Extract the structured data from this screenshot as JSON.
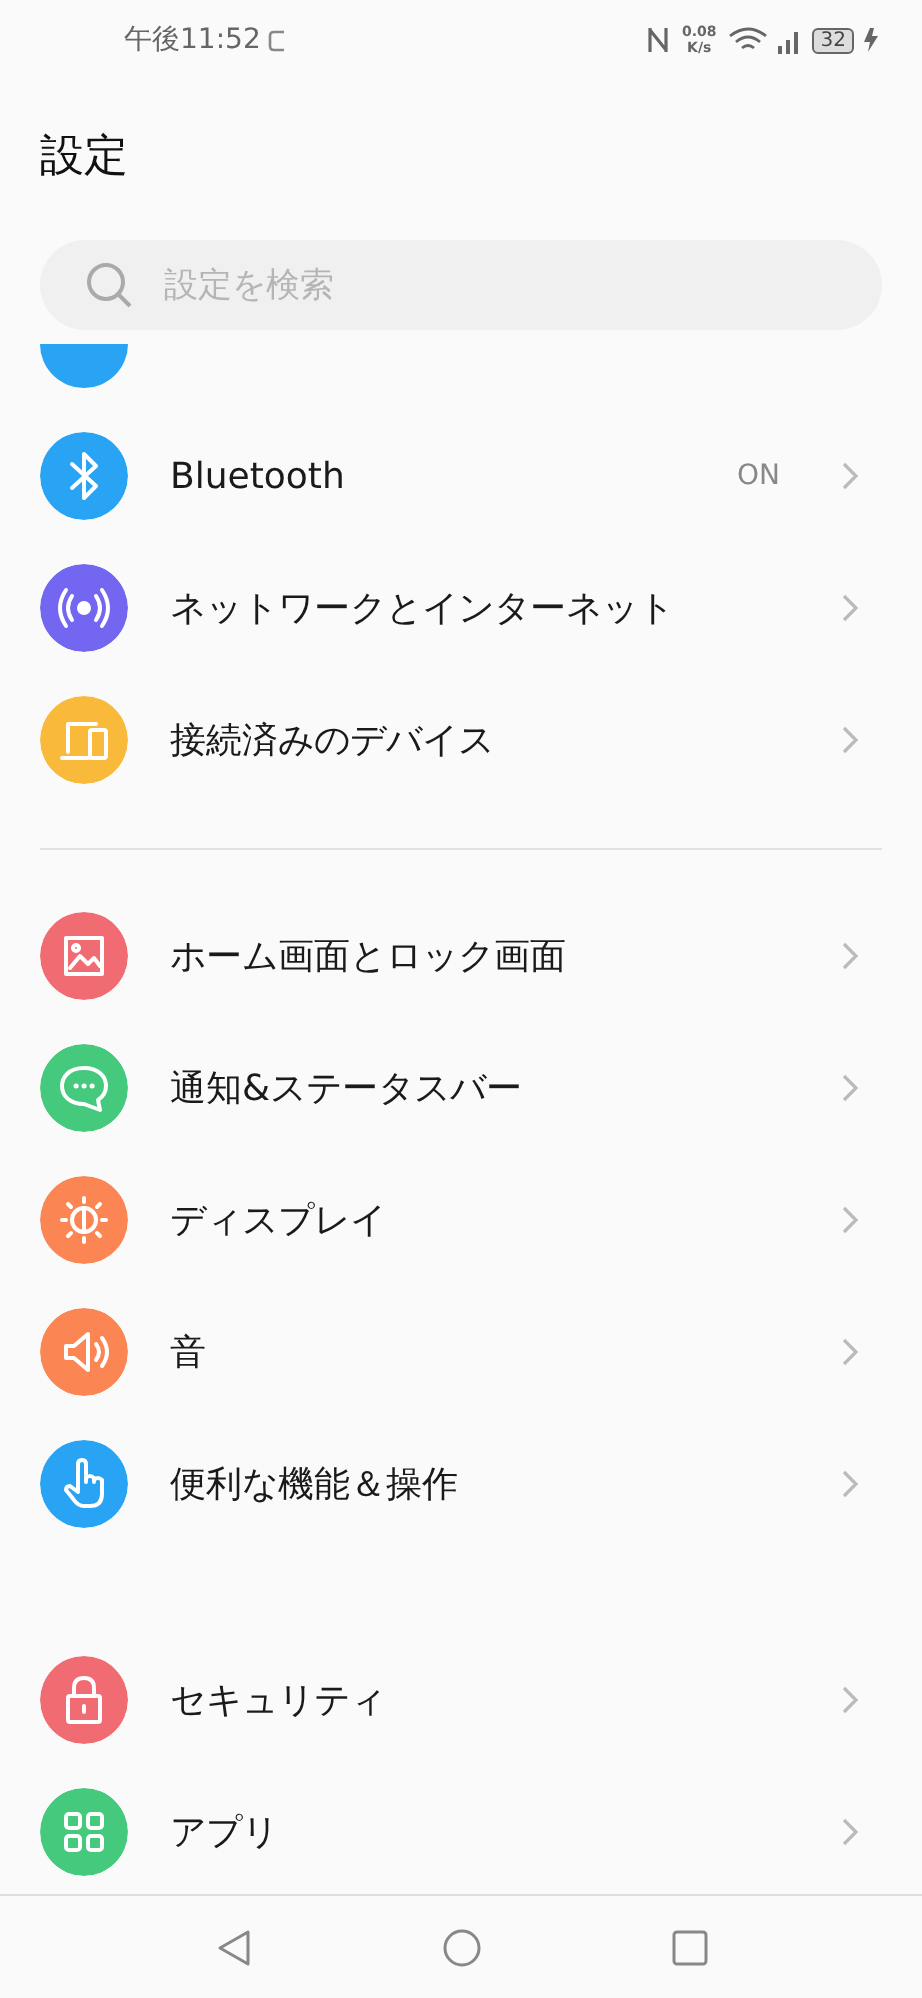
{
  "status_bar": {
    "time": "午後11:52",
    "speed_value": "0.08",
    "speed_unit": "K/s",
    "battery": "32"
  },
  "title": "設定",
  "search": {
    "placeholder": "設定を検索"
  },
  "groups": [
    {
      "items": [
        {
          "kind": "clipped",
          "color": "#29a3f3"
        },
        {
          "kind": "row",
          "label": "Bluetooth",
          "value": "ON",
          "color": "#29a3f3"
        },
        {
          "kind": "row",
          "label": "ネットワークとインターネット",
          "color": "#7366f0"
        },
        {
          "kind": "row",
          "label": "接続済みのデバイス",
          "color": "#f9b93a"
        }
      ]
    },
    {
      "divider": true,
      "items": [
        {
          "kind": "row",
          "label": "ホーム画面とロック画面",
          "color": "#f06b72"
        },
        {
          "kind": "row",
          "label": "通知&ステータスバー",
          "color": "#44c97d"
        },
        {
          "kind": "row",
          "label": "ディスプレイ",
          "color": "#fb8654"
        },
        {
          "kind": "row",
          "label": "音",
          "color": "#fb8654"
        },
        {
          "kind": "row",
          "label": "便利な機能＆操作",
          "color": "#29a3f3"
        }
      ]
    },
    {
      "divider": false,
      "items": [
        {
          "kind": "row",
          "label": "セキュリティ",
          "color": "#f06b72"
        },
        {
          "kind": "row",
          "label": "アプリ",
          "color": "#44c97d"
        }
      ]
    }
  ]
}
